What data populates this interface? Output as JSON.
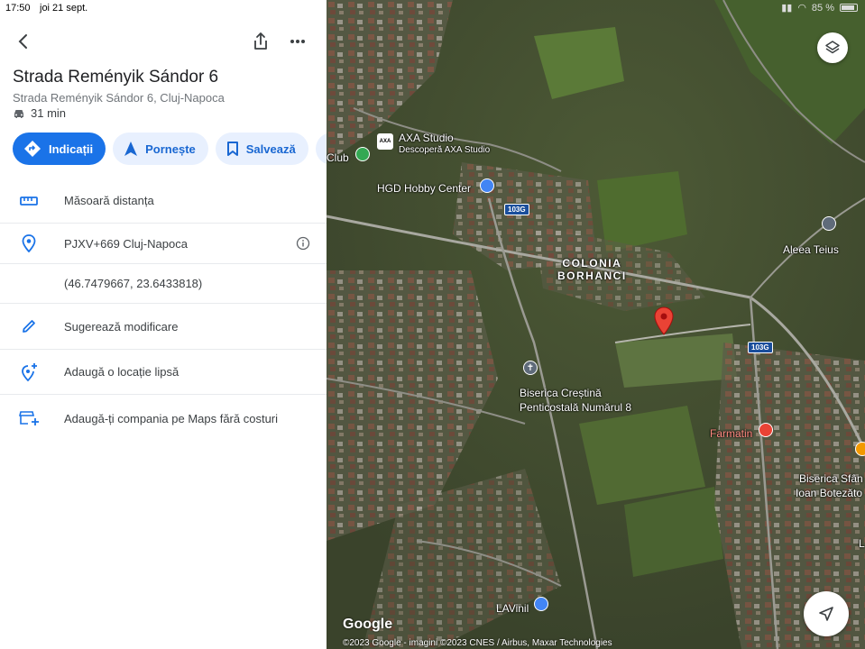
{
  "status_bar": {
    "time": "17:50",
    "date": "joi 21 sept.",
    "battery": "85 %"
  },
  "place": {
    "title": "Strada Reményik Sándor 6",
    "address": "Strada Reményik Sándor 6, Cluj-Napoca",
    "travel_time": "31 min"
  },
  "actions": [
    {
      "label": "Indicații"
    },
    {
      "label": "Pornește"
    },
    {
      "label": "Salvează"
    }
  ],
  "rows": {
    "measure": "Măsoară distanța",
    "plus_code": "PJXV+669 Cluj-Napoca",
    "coordinates": "(46.7479667, 23.6433818)",
    "suggest_edit": "Sugerează modificare",
    "add_place": "Adaugă o locație lipsă",
    "add_business": "Adaugă-ți compania pe Maps fără costuri"
  },
  "map": {
    "labels": {
      "axa_studio": "AXA Studio",
      "axa_sub": "Descoperă AXA Studio",
      "axa_logo": "AXA",
      "club": "Club",
      "hgd": "HGD Hobby Center",
      "road_103g_a": "103G",
      "road_103g_b": "103G",
      "colonia_1": "COLONIA",
      "colonia_2": "BORHANCI",
      "aleea_teius": "Aleea Teius",
      "biserica_1": "Biserica Creștină",
      "biserica_2": "Penticostală Numărul 8",
      "farmatin": "Farmatin",
      "biserica_sf_1": "Biserica Sfân",
      "biserica_sf_2": "Ioan Botezăto",
      "lavinil": "LAVinil",
      "edge_letter": "L"
    },
    "google_logo": "Google",
    "attribution": "©2023 Google - imagini ©2023 CNES / Airbus, Maxar Technologies"
  },
  "colors": {
    "accent": "#1a73e8",
    "chip_bg": "#e8f0fe",
    "pin": "#ea4335"
  }
}
